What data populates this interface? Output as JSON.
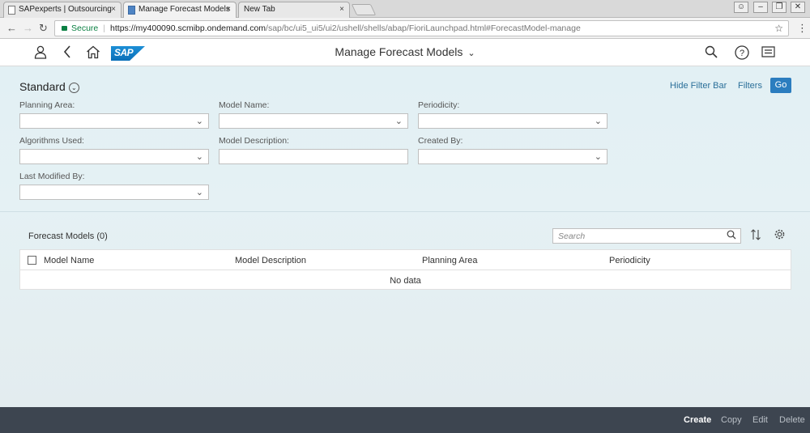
{
  "browser": {
    "tabs": [
      {
        "label": "SAPexperts | Outsourcing",
        "close": "×"
      },
      {
        "label": "Manage Forecast Models",
        "close": "×"
      },
      {
        "label": "New Tab",
        "close": "×"
      }
    ],
    "window_controls": [
      "person-icon",
      "minimize-icon",
      "maximize-icon",
      "close-icon"
    ],
    "nav_icons": [
      "back-arrow-icon",
      "forward-arrow-icon",
      "reload-icon"
    ],
    "secure_label": "Secure",
    "url_host": "https://my400090.scmibp.ondemand.com",
    "url_path": "/sap/bc/ui5_ui5/ui2/ushell/shells/abap/FioriLaunchpad.html#ForecastModel-manage"
  },
  "shell": {
    "logo_text": "SAP",
    "title": "Manage Forecast Models",
    "left_icons": [
      "user-icon",
      "back-icon",
      "home-icon"
    ],
    "right_icons": [
      "search-icon",
      "help-icon",
      "notifications-icon"
    ]
  },
  "filterbar": {
    "variant": "Standard",
    "hide_label": "Hide Filter Bar",
    "filters_label": "Filters",
    "go_label": "Go",
    "fields": {
      "planning_area": "Planning Area:",
      "model_name": "Model Name:",
      "periodicity": "Periodicity:",
      "algorithms_used": "Algorithms Used:",
      "model_description": "Model Description:",
      "created_by": "Created By:",
      "last_modified_by": "Last Modified By:"
    }
  },
  "table": {
    "title": "Forecast Models (0)",
    "search_placeholder": "Search",
    "columns": [
      "Model Name",
      "Model Description",
      "Planning Area",
      "Periodicity"
    ],
    "empty_text": "No data"
  },
  "footer": {
    "actions": [
      "Create",
      "Copy",
      "Edit",
      "Delete"
    ]
  },
  "colors": {
    "brand_blue": "#2b7dbf",
    "footer_bg": "#3d4550",
    "secure_green": "#0b8043"
  }
}
